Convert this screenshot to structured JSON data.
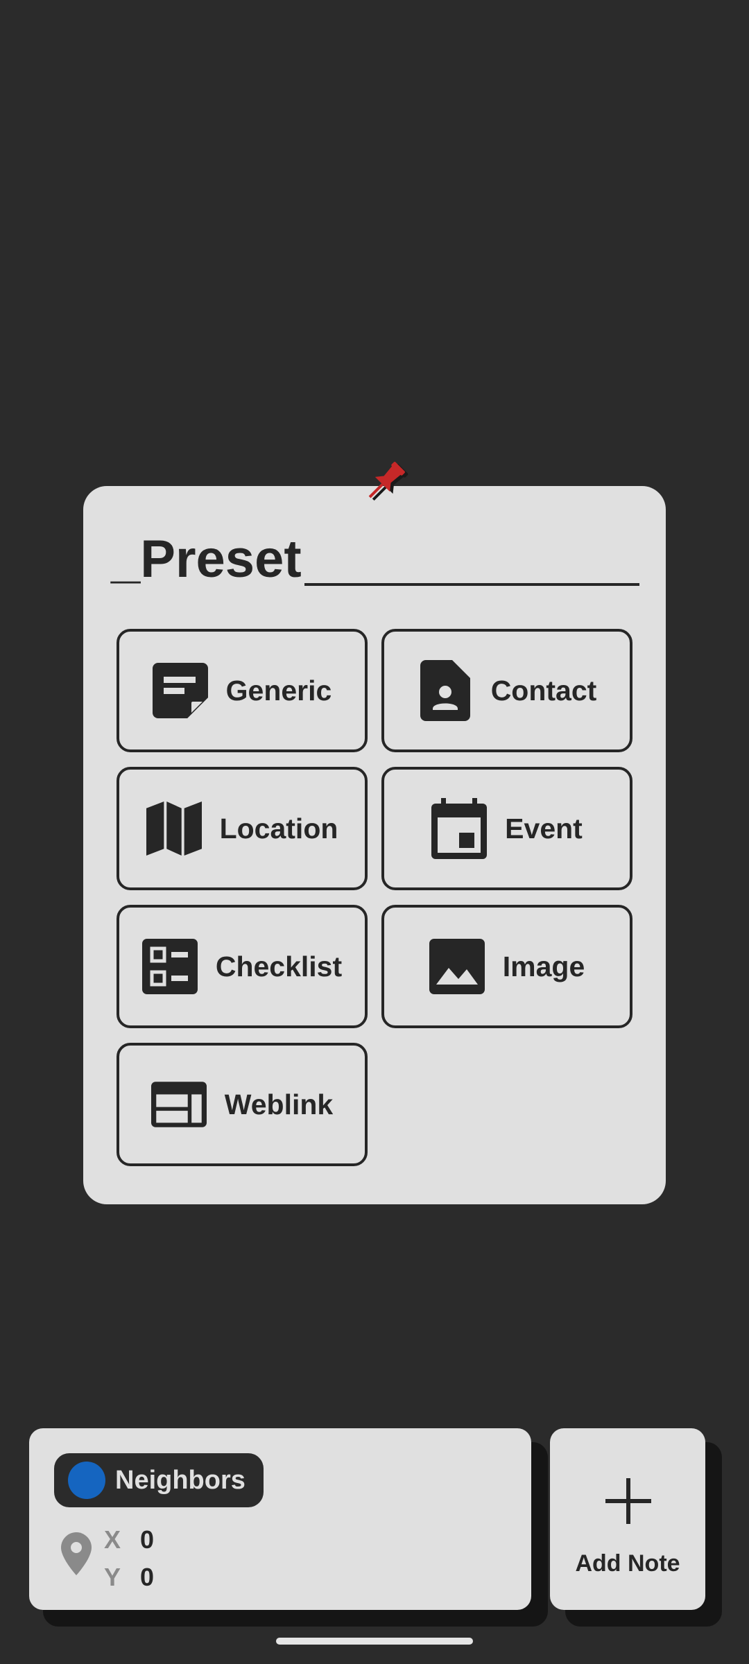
{
  "preset_dialog": {
    "title": "_Preset",
    "items": [
      {
        "label": "Generic",
        "icon": "note-icon"
      },
      {
        "label": "Contact",
        "icon": "contact-icon"
      },
      {
        "label": "Location",
        "icon": "map-icon"
      },
      {
        "label": "Event",
        "icon": "calendar-event-icon"
      },
      {
        "label": "Checklist",
        "icon": "checklist-icon"
      },
      {
        "label": "Image",
        "icon": "image-icon"
      },
      {
        "label": "Weblink",
        "icon": "web-icon"
      }
    ]
  },
  "info_panel": {
    "layer_name": "Neighbors",
    "layer_color": "#1565c0",
    "x_label": "X",
    "x_value": "0",
    "y_label": "Y",
    "y_value": "0"
  },
  "add_button": {
    "label": "Add Note"
  },
  "colors": {
    "background": "#2b2b2b",
    "card": "#e0e0e0",
    "ink": "#262626",
    "pin": "#c62828"
  }
}
